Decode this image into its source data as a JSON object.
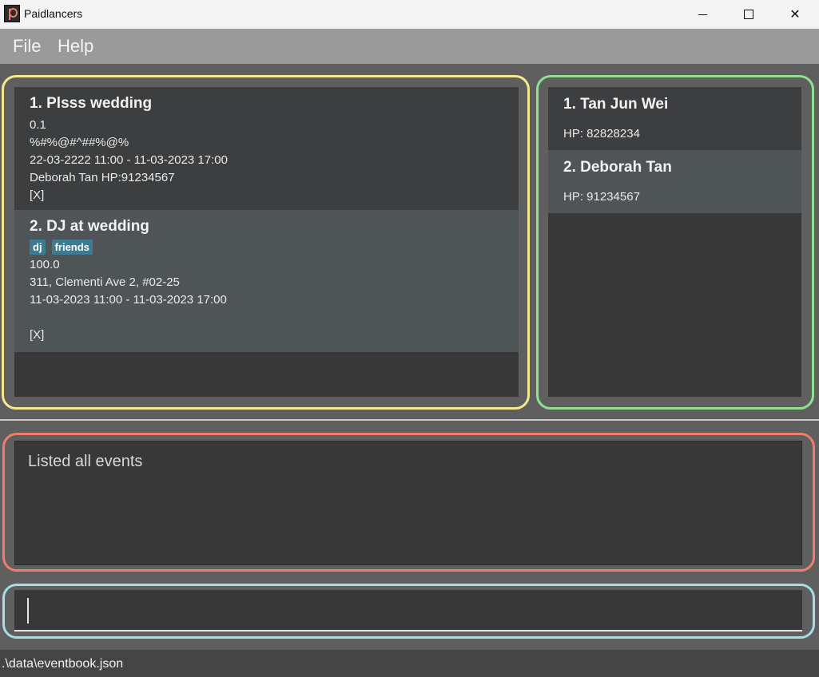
{
  "window": {
    "title": "Paidlancers",
    "app_icon": "paidlancers-logo-icon"
  },
  "menubar": {
    "items": [
      {
        "label": "File"
      },
      {
        "label": "Help"
      }
    ]
  },
  "events": [
    {
      "title": "1.  Plsss wedding",
      "tags": [],
      "lines": [
        "0.1",
        "%#%@#^##%@%",
        "22-03-2222 11:00 - 11-03-2023 17:00",
        "Deborah Tan HP:91234567",
        "[X]"
      ]
    },
    {
      "title": "2.  DJ at wedding",
      "tags": [
        "dj",
        "friends"
      ],
      "lines": [
        "100.0",
        "311, Clementi Ave 2, #02-25",
        "11-03-2023 11:00 - 11-03-2023 17:00",
        "",
        "[X]"
      ]
    }
  ],
  "contacts": [
    {
      "name": "1. Tan Jun Wei",
      "hp": "HP: 82828234"
    },
    {
      "name": "2. Deborah Tan",
      "hp": "HP: 91234567"
    }
  ],
  "result_display": {
    "text": "Listed all events"
  },
  "command_box": {
    "value": ""
  },
  "status_bar": {
    "path": ".\\data\\eventbook.json"
  },
  "colors": {
    "outline_event_list": "#f6e98c",
    "outline_contact_list": "#8fe08f",
    "outline_result": "#ef7d6c",
    "outline_command": "#a7dbe6",
    "tag_bg": "#3e7b91"
  }
}
